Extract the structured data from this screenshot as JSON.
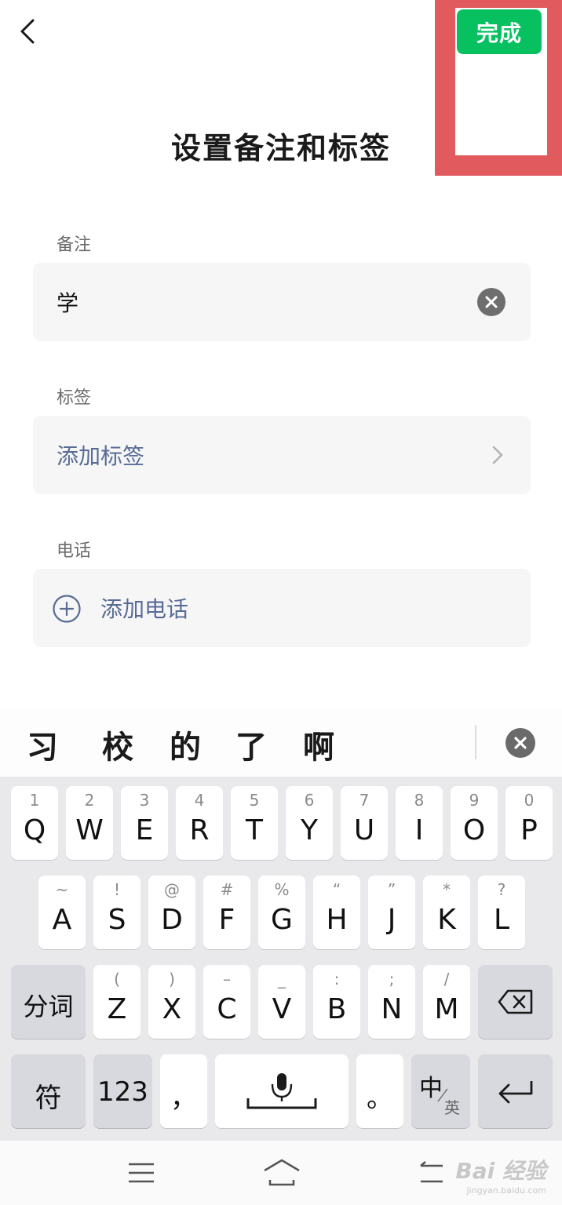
{
  "header": {
    "back_icon": "chevron-left-icon",
    "done_label": "完成",
    "done_color": "#07c160",
    "highlight_color": "#e05a5e",
    "title": "设置备注和标签"
  },
  "remark": {
    "label": "备注",
    "value": "学",
    "clear_icon": "clear-circle-icon"
  },
  "tags": {
    "label": "标签",
    "link": "添加标签",
    "chevron_icon": "chevron-right-icon"
  },
  "phone": {
    "label": "电话",
    "link": "添加电话",
    "plus_icon": "plus-circle-icon"
  },
  "candidates": {
    "items": [
      "习",
      "校",
      "的",
      "了",
      "啊"
    ],
    "close_icon": "close-circle-icon"
  },
  "keyboard": {
    "row1": [
      {
        "num": "1",
        "key": "Q"
      },
      {
        "num": "2",
        "key": "W"
      },
      {
        "num": "3",
        "key": "E"
      },
      {
        "num": "4",
        "key": "R"
      },
      {
        "num": "5",
        "key": "T"
      },
      {
        "num": "6",
        "key": "Y"
      },
      {
        "num": "7",
        "key": "U"
      },
      {
        "num": "8",
        "key": "I"
      },
      {
        "num": "9",
        "key": "O"
      },
      {
        "num": "0",
        "key": "P"
      }
    ],
    "row2": [
      {
        "sym": "~",
        "key": "A"
      },
      {
        "sym": "!",
        "key": "S"
      },
      {
        "sym": "@",
        "key": "D"
      },
      {
        "sym": "#",
        "key": "F"
      },
      {
        "sym": "%",
        "key": "G"
      },
      {
        "sym": "“",
        "key": "H"
      },
      {
        "sym": "”",
        "key": "J"
      },
      {
        "sym": "*",
        "key": "K"
      },
      {
        "sym": "?",
        "key": "L"
      }
    ],
    "row3": [
      {
        "sym": "(",
        "key": "Z"
      },
      {
        "sym": ")",
        "key": "X"
      },
      {
        "sym": "–",
        "key": "C"
      },
      {
        "sym": "_",
        "key": "V"
      },
      {
        "sym": ":",
        "key": "B"
      },
      {
        "sym": ";",
        "key": "N"
      },
      {
        "sym": "/",
        "key": "M"
      }
    ],
    "segment_label": "分词",
    "backspace_icon": "backspace-icon",
    "symbol_label": "符",
    "numeric_label": "123",
    "comma": "，",
    "mic_icon": "microphone-icon",
    "period": "。",
    "lang_main": "中",
    "lang_sub": "英",
    "enter_icon": "enter-icon"
  },
  "navbar": {
    "menu_icon": "menu-icon",
    "home_icon": "home-icon",
    "back_icon": "back-icon"
  },
  "watermark": {
    "brand": "Bai 经验",
    "url": "jingyan.baidu.com"
  }
}
